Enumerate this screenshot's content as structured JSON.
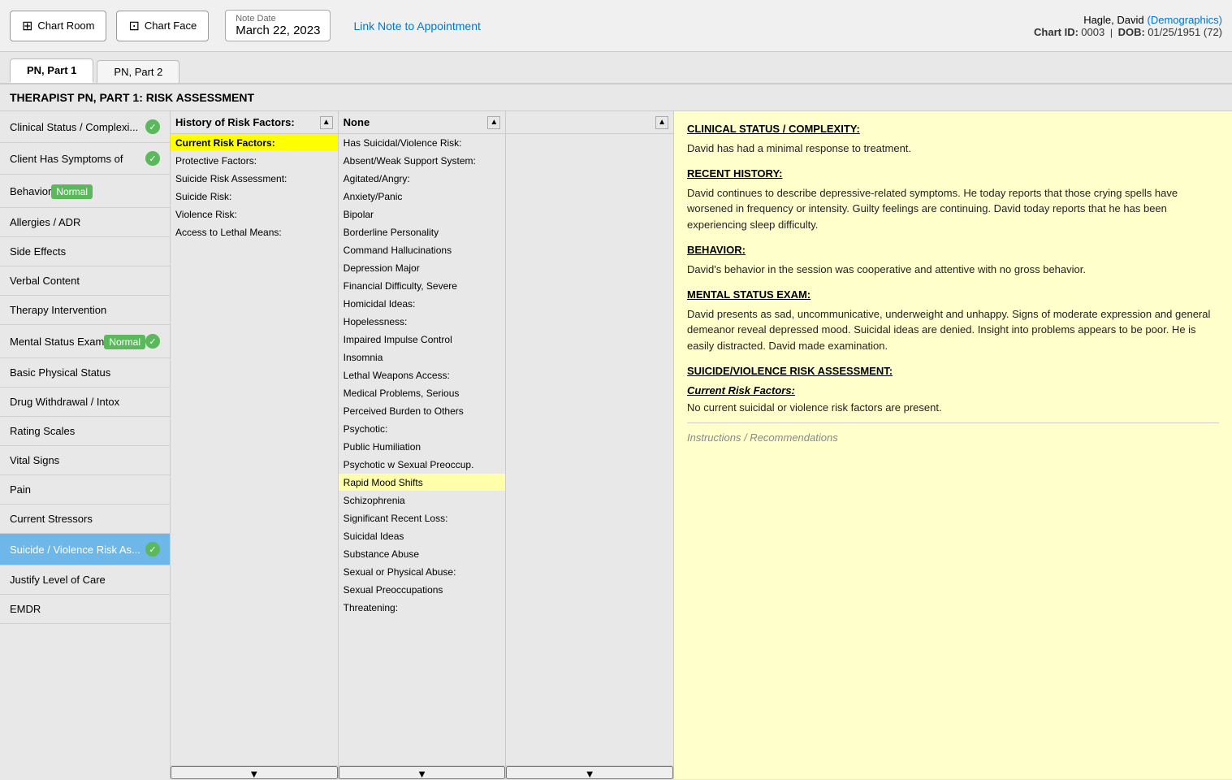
{
  "header": {
    "chart_room_label": "Chart Room",
    "chart_face_label": "Chart Face",
    "note_date_label": "Note Date",
    "note_date_value": "March 22, 2023",
    "link_appointment": "Link Note to Appointment",
    "patient_name": "Hagle, David",
    "demographics_link": "Demographics",
    "chart_id_label": "Chart ID:",
    "chart_id_value": "0003",
    "dob_label": "DOB:",
    "dob_value": "01/25/1951 (72)"
  },
  "tabs": [
    {
      "label": "PN, Part 1",
      "active": true
    },
    {
      "label": "PN, Part 2",
      "active": false
    }
  ],
  "page_title": "THERAPIST PN, PART 1: RISK ASSESSMENT",
  "left_nav": {
    "items": [
      {
        "label": "Clinical Status / Complexi...",
        "checked": true,
        "active": false,
        "badge": null
      },
      {
        "label": "Client Has Symptoms of",
        "checked": true,
        "active": false,
        "badge": null
      },
      {
        "label": "Behavior",
        "checked": false,
        "active": false,
        "badge": "Normal"
      },
      {
        "label": "Allergies / ADR",
        "checked": false,
        "active": false,
        "badge": null
      },
      {
        "label": "Side Effects",
        "checked": false,
        "active": false,
        "badge": null
      },
      {
        "label": "Verbal Content",
        "checked": false,
        "active": false,
        "badge": null
      },
      {
        "label": "Therapy Intervention",
        "checked": false,
        "active": false,
        "badge": null
      },
      {
        "label": "Mental Status Exam",
        "checked": true,
        "active": false,
        "badge": "Normal"
      },
      {
        "label": "Basic Physical Status",
        "checked": false,
        "active": false,
        "badge": null
      },
      {
        "label": "Drug Withdrawal / Intox",
        "checked": false,
        "active": false,
        "badge": null
      },
      {
        "label": "Rating Scales",
        "checked": false,
        "active": false,
        "badge": null
      },
      {
        "label": "Vital Signs",
        "checked": false,
        "active": false,
        "badge": null
      },
      {
        "label": "Pain",
        "checked": false,
        "active": false,
        "badge": null
      },
      {
        "label": "Current Stressors",
        "checked": false,
        "active": false,
        "badge": null
      },
      {
        "label": "Suicide / Violence Risk As...",
        "checked": true,
        "active": true,
        "badge": null
      },
      {
        "label": "Justify Level of Care",
        "checked": false,
        "active": false,
        "badge": null
      },
      {
        "label": "EMDR",
        "checked": false,
        "active": false,
        "badge": null
      }
    ]
  },
  "list_columns": {
    "col1": {
      "header": "History of Risk Factors:",
      "items": [
        {
          "label": "Current Risk Factors:",
          "selected": true
        },
        {
          "label": "Protective Factors:"
        },
        {
          "label": "Suicide Risk Assessment:"
        },
        {
          "label": "Suicide Risk:"
        },
        {
          "label": "Violence Risk:"
        },
        {
          "label": "Access to Lethal Means:"
        },
        {
          "label": ""
        },
        {
          "label": ""
        },
        {
          "label": ""
        },
        {
          "label": ""
        },
        {
          "label": ""
        },
        {
          "label": ""
        },
        {
          "label": ""
        },
        {
          "label": ""
        },
        {
          "label": ""
        },
        {
          "label": ""
        },
        {
          "label": ""
        },
        {
          "label": ""
        },
        {
          "label": ""
        },
        {
          "label": ""
        },
        {
          "label": ""
        },
        {
          "label": ""
        },
        {
          "label": ""
        },
        {
          "label": ""
        },
        {
          "label": ""
        },
        {
          "label": ""
        }
      ]
    },
    "col2": {
      "header": "None",
      "items": [
        {
          "label": "Has Suicidal/Violence Risk:"
        },
        {
          "label": "Absent/Weak Support System:"
        },
        {
          "label": "Agitated/Angry:"
        },
        {
          "label": "Anxiety/Panic"
        },
        {
          "label": "Bipolar"
        },
        {
          "label": "Borderline Personality"
        },
        {
          "label": "Command Hallucinations"
        },
        {
          "label": "Depression Major"
        },
        {
          "label": "Financial Difficulty, Severe"
        },
        {
          "label": "Homicidal Ideas:"
        },
        {
          "label": "Hopelessness:"
        },
        {
          "label": "Impaired Impulse Control"
        },
        {
          "label": "Insomnia"
        },
        {
          "label": "Lethal Weapons Access:"
        },
        {
          "label": "Medical Problems, Serious"
        },
        {
          "label": "Perceived Burden to Others"
        },
        {
          "label": "Psychotic:"
        },
        {
          "label": "Public Humiliation"
        },
        {
          "label": "Psychotic w Sexual Preoccup."
        },
        {
          "label": "Rapid Mood Shifts",
          "highlighted": true
        },
        {
          "label": "Schizophrenia"
        },
        {
          "label": "Significant Recent Loss:"
        },
        {
          "label": "Suicidal Ideas"
        },
        {
          "label": "Substance Abuse"
        },
        {
          "label": "Sexual or Physical Abuse:"
        },
        {
          "label": "Sexual Preoccupations"
        },
        {
          "label": "Threatening:"
        }
      ]
    },
    "col3": {
      "header": "",
      "items": [
        {
          "label": ""
        },
        {
          "label": ""
        },
        {
          "label": ""
        },
        {
          "label": ""
        },
        {
          "label": ""
        },
        {
          "label": ""
        },
        {
          "label": ""
        },
        {
          "label": ""
        },
        {
          "label": ""
        },
        {
          "label": ""
        },
        {
          "label": ""
        },
        {
          "label": ""
        },
        {
          "label": ""
        },
        {
          "label": ""
        },
        {
          "label": ""
        },
        {
          "label": ""
        },
        {
          "label": ""
        },
        {
          "label": ""
        },
        {
          "label": ""
        },
        {
          "label": ""
        },
        {
          "label": ""
        },
        {
          "label": ""
        },
        {
          "label": ""
        },
        {
          "label": ""
        },
        {
          "label": ""
        },
        {
          "label": ""
        },
        {
          "label": ""
        }
      ]
    }
  },
  "right_panel": {
    "sections": [
      {
        "heading": "CLINICAL STATUS / COMPLEXITY:",
        "text": "David has had a minimal response to treatment."
      },
      {
        "heading": "RECENT HISTORY:",
        "text": "David continues to describe depressive-related symptoms. He today reports that those crying spells have worsened in frequency or intensity. Guilty feelings are continuing. David today reports that he has been experiencing sleep difficulty."
      },
      {
        "heading": "BEHAVIOR:",
        "text": "David's behavior in the session was cooperative and attentive with no gross behavior."
      },
      {
        "heading": "MENTAL STATUS EXAM:",
        "text": "David presents as sad, uncommunicative, underweight and unhappy. Signs of moderate expression and general demeanor reveal depressed mood. Suicidal ideas are denied. Insight into problems appears to be poor. He is easily distracted. David made examination."
      },
      {
        "heading": "SUICIDE/VIOLENCE RISK ASSESSMENT:",
        "text": ""
      },
      {
        "subheading": "Current Risk Factors:",
        "text": "No current suicidal or violence risk factors are present."
      }
    ],
    "instructions_label": "Instructions / Recommendations"
  }
}
